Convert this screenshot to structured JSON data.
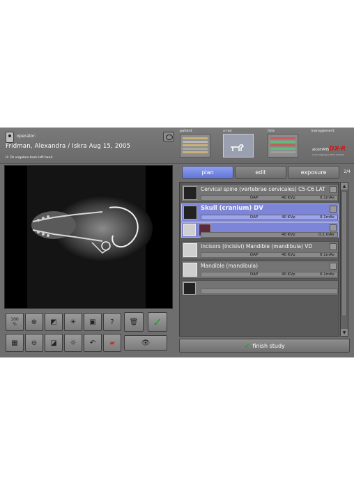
{
  "header": {
    "operator_label": "operator:",
    "patient_line": "Fridman, Alexandra / Iskra  Aug 15, 2005",
    "sub_line": "H: Os ungulare back left hand"
  },
  "nav_tabs": [
    {
      "label": "patient"
    },
    {
      "label": "x-ray"
    },
    {
      "label": "lists"
    },
    {
      "label": "management"
    }
  ],
  "logo": {
    "line1": "alcomMIS",
    "line2": "DX-R",
    "line3": "X-ray imaging & PACS systems"
  },
  "tabs": {
    "plan": "plan",
    "edit": "edit",
    "exposure": "exposure",
    "page_indicator": "2/4"
  },
  "studies": [
    {
      "title": "Cervical spine (vertebrae cervicales) C5-C6 LAT",
      "dap": "DAP",
      "kvp": "40 KVp",
      "mas": "0.1mAs"
    },
    {
      "title": "Skull (cranium) DV",
      "dap": "DAP",
      "kvp": "40 KVp",
      "mas": "0.1mAs",
      "row2_kvp": "40 KVp",
      "row2_mas": "0.1 mAs"
    },
    {
      "title": "Incisors (incisivi) Mandible (mandibula) VD",
      "dap": "DAP",
      "kvp": "40 KVp",
      "mas": "0.1mAs"
    },
    {
      "title": "Mandible (mandibula)",
      "dap": "DAP",
      "kvp": "40 KVp",
      "mas": "0.1mAs"
    }
  ],
  "toolbar": {
    "zoom100": "100\n%"
  },
  "finish_label": "finish study",
  "colors": {
    "accent": "#7d85d8",
    "background": "#6e6e6e"
  }
}
